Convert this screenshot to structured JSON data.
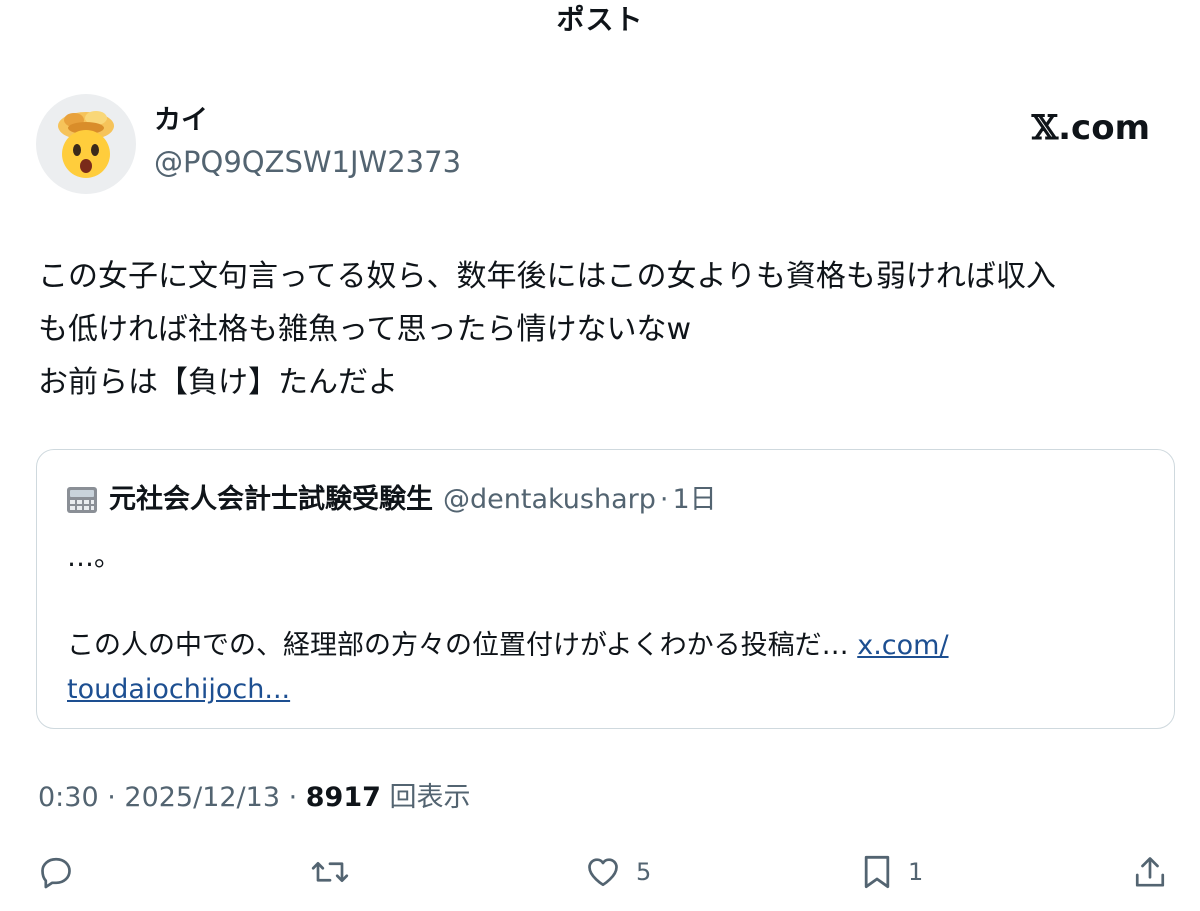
{
  "topbar": {
    "title": "ポスト"
  },
  "author": {
    "name": "カイ",
    "handle": "@PQ9QZSW1JW2373",
    "avatar_icon": "exploding-head-icon"
  },
  "brand": {
    "x": "𝕏",
    "suffix": ".com"
  },
  "post": {
    "text_lines": [
      "この女子に文句言ってる奴ら、数年後にはこの女よりも資格も弱ければ収入",
      "も低ければ社格も雑魚って思ったら情けないなw",
      "お前らは【負け】たんだよ"
    ]
  },
  "quote": {
    "icon": "abacus-icon",
    "name": "元社会人会計士試験受験生",
    "handle": "@dentakusharp",
    "separator": "·",
    "time": "1日",
    "line1": "…。",
    "line2": "この人の中での、経理部の方々の位置付けがよくわかる投稿だ… ",
    "link_part1": "x.com/",
    "link_part2": "toudaiochijoch..."
  },
  "meta": {
    "time": "0:30",
    "sep1": " · ",
    "date": "2025/12/13",
    "sep2": " · ",
    "views_count": "8917",
    "views_label": " 回表示"
  },
  "actions": {
    "reply": {
      "icon": "reply-icon",
      "count": ""
    },
    "repost": {
      "icon": "repost-icon",
      "count": ""
    },
    "like": {
      "icon": "heart-icon",
      "count": "5"
    },
    "bookmark": {
      "icon": "bookmark-icon",
      "count": "1"
    },
    "share": {
      "icon": "share-icon",
      "count": ""
    }
  },
  "colors": {
    "text": "#0f1419",
    "secondary": "#536471",
    "border": "#cfd9de",
    "link": "#1d4f91",
    "avatar_bg": "#eceef0"
  }
}
